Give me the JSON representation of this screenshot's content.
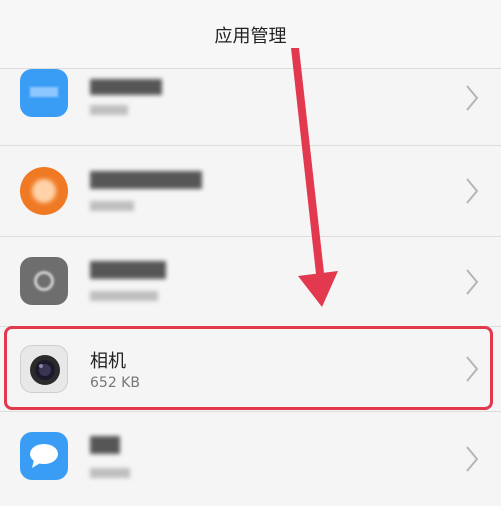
{
  "header": {
    "title": "应用管理"
  },
  "apps": [
    {
      "icon": "blurred-blue-app-icon",
      "name": "",
      "size": ""
    },
    {
      "icon": "blurred-orange-app-icon",
      "name": "",
      "size": ""
    },
    {
      "icon": "blurred-gray-app-icon",
      "name": "",
      "size": ""
    },
    {
      "icon": "camera-icon",
      "name": "相机",
      "size": "652 KB"
    },
    {
      "icon": "chat-bubble-icon",
      "name": "",
      "size": ""
    }
  ],
  "annotation": {
    "color": "#e2394f",
    "arrow_icon": "red-down-arrow"
  },
  "colors": {
    "highlight": "#e2394f",
    "blue_app": "#3a9df5",
    "orange_app": "#f07a24"
  }
}
